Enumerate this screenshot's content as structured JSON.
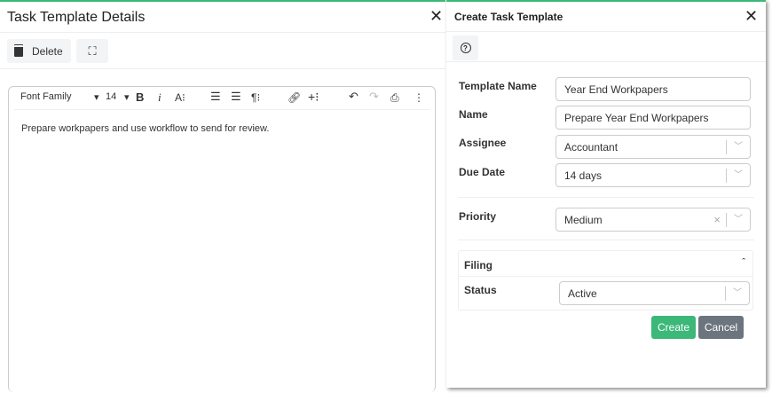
{
  "left": {
    "title": "Task Template Details",
    "delete_label": "Delete",
    "editor": {
      "font_family": "Font Family",
      "font_size": "14",
      "content": "Prepare workpapers and use workflow to send for review."
    }
  },
  "right": {
    "title": "Create Task Template",
    "fields": {
      "template_name_label": "Template Name",
      "template_name": "Year End Workpapers",
      "name_label": "Name",
      "name": "Prepare Year End Workpapers",
      "assignee_label": "Assignee",
      "assignee": "Accountant",
      "due_label": "Due Date",
      "due": "14 days",
      "priority_label": "Priority",
      "priority": "Medium"
    },
    "filing": {
      "title": "Filing",
      "status_label": "Status",
      "status": "Active"
    },
    "create_label": "Create",
    "cancel_label": "Cancel"
  },
  "colors": {
    "accent": "#3cb878",
    "create": "#3cb878",
    "cancel": "#6c757d"
  }
}
